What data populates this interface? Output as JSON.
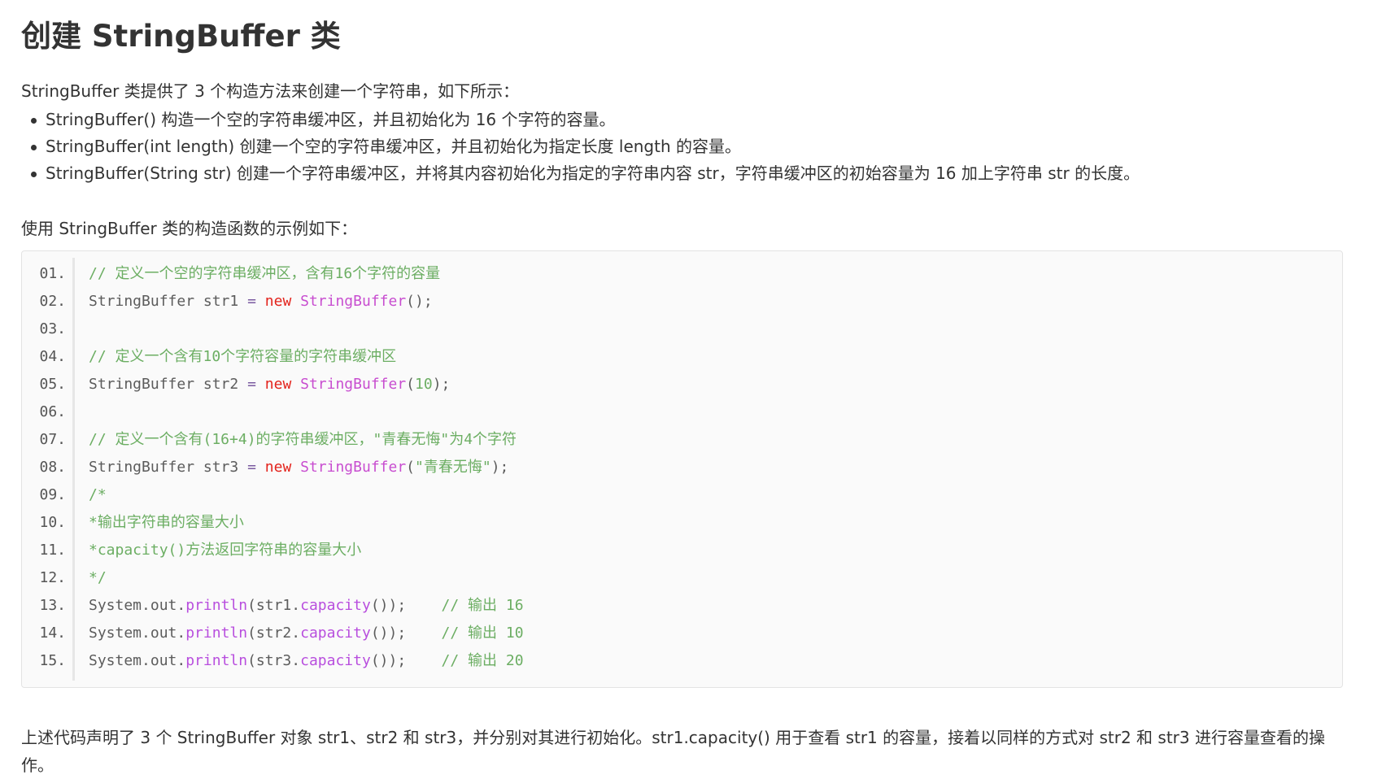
{
  "title": "创建 StringBuffer 类",
  "intro": "StringBuffer 类提供了 3 个构造方法来创建一个字符串，如下所示：",
  "bullets": [
    "StringBuffer() 构造一个空的字符串缓冲区，并且初始化为 16 个字符的容量。",
    "StringBuffer(int length) 创建一个空的字符串缓冲区，并且初始化为指定长度 length 的容量。",
    "StringBuffer(String str) 创建一个字符串缓冲区，并将其内容初始化为指定的字符串内容 str，字符串缓冲区的初始容量为 16 加上字符串 str 的长度。"
  ],
  "example_intro": "使用 StringBuffer 类的构造函数的示例如下：",
  "code": {
    "line_numbers": [
      "01.",
      "02.",
      "03.",
      "04.",
      "05.",
      "06.",
      "07.",
      "08.",
      "09.",
      "10.",
      "11.",
      "12.",
      "13.",
      "14.",
      "15."
    ],
    "lines": [
      [
        {
          "t": "comment",
          "v": "// 定义一个空的字符串缓冲区，含有16个字符的容量"
        }
      ],
      [
        {
          "t": "plain",
          "v": "StringBuffer str1 "
        },
        {
          "t": "op",
          "v": "="
        },
        {
          "t": "plain",
          "v": " "
        },
        {
          "t": "keyword",
          "v": "new"
        },
        {
          "t": "plain",
          "v": " "
        },
        {
          "t": "class",
          "v": "StringBuffer"
        },
        {
          "t": "plain",
          "v": "();"
        }
      ],
      [],
      [
        {
          "t": "comment",
          "v": "// 定义一个含有10个字符容量的字符串缓冲区"
        }
      ],
      [
        {
          "t": "plain",
          "v": "StringBuffer str2 "
        },
        {
          "t": "op",
          "v": "="
        },
        {
          "t": "plain",
          "v": " "
        },
        {
          "t": "keyword",
          "v": "new"
        },
        {
          "t": "plain",
          "v": " "
        },
        {
          "t": "class",
          "v": "StringBuffer"
        },
        {
          "t": "plain",
          "v": "("
        },
        {
          "t": "number",
          "v": "10"
        },
        {
          "t": "plain",
          "v": ");"
        }
      ],
      [],
      [
        {
          "t": "comment",
          "v": "// 定义一个含有(16+4)的字符串缓冲区，\"青春无悔\"为4个字符"
        }
      ],
      [
        {
          "t": "plain",
          "v": "StringBuffer str3 "
        },
        {
          "t": "op",
          "v": "="
        },
        {
          "t": "plain",
          "v": " "
        },
        {
          "t": "keyword",
          "v": "new"
        },
        {
          "t": "plain",
          "v": " "
        },
        {
          "t": "class",
          "v": "StringBuffer"
        },
        {
          "t": "plain",
          "v": "("
        },
        {
          "t": "string",
          "v": "\"青春无悔\""
        },
        {
          "t": "plain",
          "v": ");"
        }
      ],
      [
        {
          "t": "comment",
          "v": "/*"
        }
      ],
      [
        {
          "t": "comment",
          "v": "*输出字符串的容量大小"
        }
      ],
      [
        {
          "t": "comment",
          "v": "*capacity()方法返回字符串的容量大小"
        }
      ],
      [
        {
          "t": "comment",
          "v": "*/"
        }
      ],
      [
        {
          "t": "plain",
          "v": "System.out."
        },
        {
          "t": "method",
          "v": "println"
        },
        {
          "t": "plain",
          "v": "(str1."
        },
        {
          "t": "method",
          "v": "capacity"
        },
        {
          "t": "plain",
          "v": "());    "
        },
        {
          "t": "comment",
          "v": "// 输出 16"
        }
      ],
      [
        {
          "t": "plain",
          "v": "System.out."
        },
        {
          "t": "method",
          "v": "println"
        },
        {
          "t": "plain",
          "v": "(str2."
        },
        {
          "t": "method",
          "v": "capacity"
        },
        {
          "t": "plain",
          "v": "());    "
        },
        {
          "t": "comment",
          "v": "// 输出 10"
        }
      ],
      [
        {
          "t": "plain",
          "v": "System.out."
        },
        {
          "t": "method",
          "v": "println"
        },
        {
          "t": "plain",
          "v": "(str3."
        },
        {
          "t": "method",
          "v": "capacity"
        },
        {
          "t": "plain",
          "v": "());    "
        },
        {
          "t": "comment",
          "v": "// 输出 20"
        }
      ]
    ]
  },
  "summary": "上述代码声明了 3 个 StringBuffer 对象 str1、str2 和 str3，并分别对其进行初始化。str1.capacity() 用于查看 str1 的容量，接着以同样的方式对 str2 和 str3 进行容量查看的操作。",
  "colors": {
    "comment": "#6cae63",
    "keyword": "#e3231c",
    "class": "#c84ed0",
    "method": "#b84ede",
    "plain": "#5c5c5c",
    "code_background": "#fafafa"
  }
}
